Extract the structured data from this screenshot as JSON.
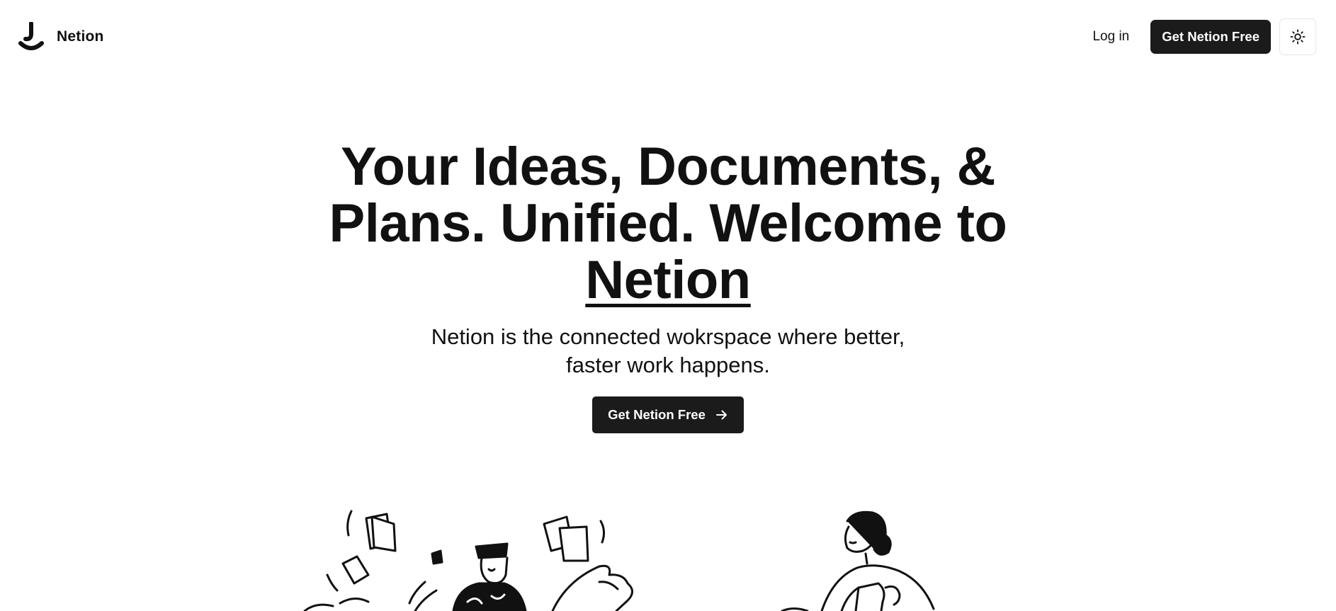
{
  "header": {
    "brand_name": "Netion",
    "login_label": "Log in",
    "cta_label": "Get Netion Free",
    "theme_icon": "sun-icon",
    "logo_icon": "netion-logo-icon"
  },
  "hero": {
    "headline_lead": "Your Ideas, Documents, & Plans. Unified. Welcome to",
    "headline_brand": "Netion",
    "subhead": "Netion is the connected wokrspace where better, faster work happens.",
    "cta_label": "Get Netion Free",
    "cta_icon": "arrow-right-icon"
  },
  "illustrations": {
    "left": "people-juggling-documents-illustration",
    "right": "person-reading-illustration"
  },
  "colors": {
    "background": "#ffffff",
    "text": "#111111",
    "button": "#1b1b1b",
    "button_text": "#ffffff"
  }
}
